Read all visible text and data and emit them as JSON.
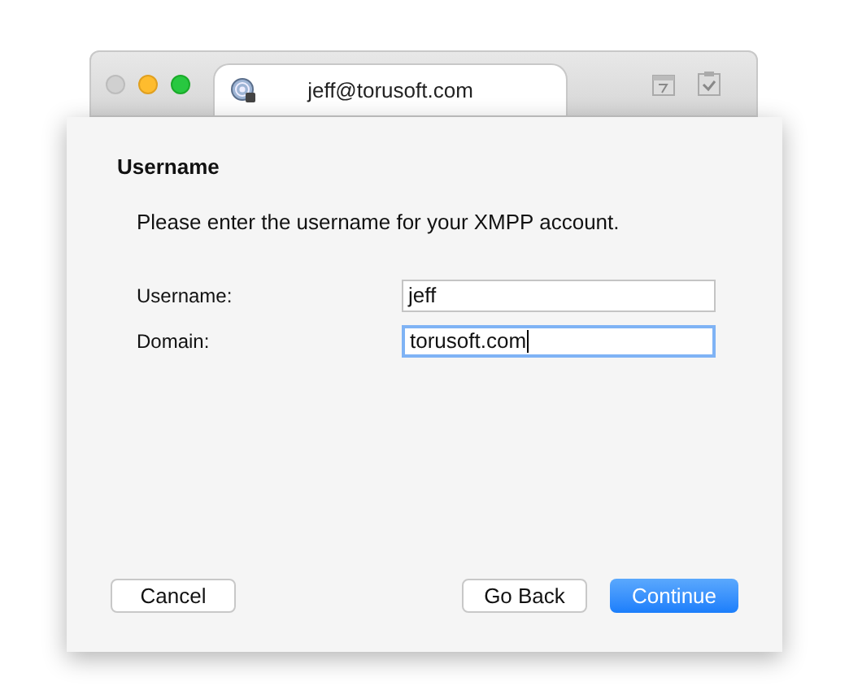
{
  "window": {
    "tab": {
      "title": "jeff@torusoft.com",
      "selected": true
    }
  },
  "sheet": {
    "heading": "Username",
    "instructions": "Please enter the username for your XMPP account.",
    "fields": [
      {
        "label": "Username:",
        "value": "jeff",
        "focused": false
      },
      {
        "label": "Domain:",
        "value": "torusoft.com",
        "focused": true
      }
    ],
    "buttons": [
      {
        "label": "Cancel",
        "kind": "secondary"
      },
      {
        "label": "Go Back",
        "kind": "secondary"
      },
      {
        "label": "Continue",
        "kind": "primary"
      }
    ]
  }
}
